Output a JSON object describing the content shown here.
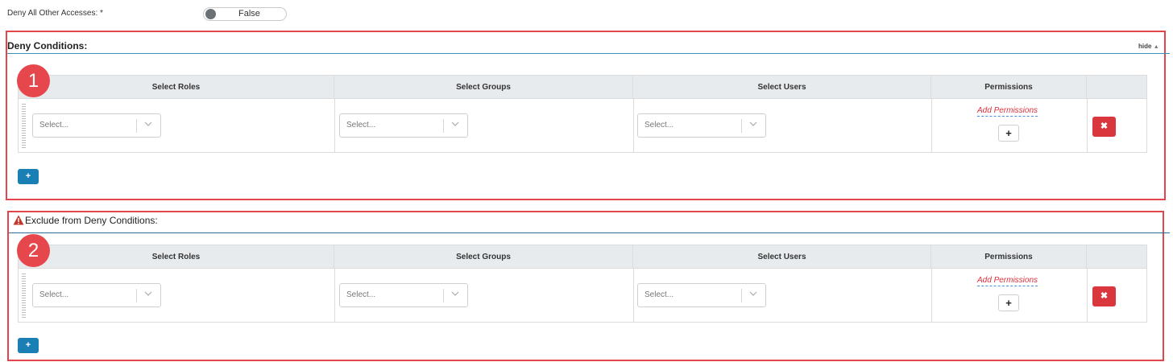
{
  "deny_all": {
    "label": "Deny All Other Accesses: *",
    "toggle_value": "False"
  },
  "deny_conditions": {
    "title": "Deny Conditions:",
    "hide_label": "hide",
    "badge": "1",
    "columns": [
      "Select Roles",
      "Select Groups",
      "Select Users",
      "Permissions"
    ],
    "row": {
      "roles_placeholder": "Select...",
      "groups_placeholder": "Select...",
      "users_placeholder": "Select...",
      "add_permissions": "Add Permissions",
      "plus": "+",
      "delete": "✖"
    },
    "add_row": "+"
  },
  "exclude_conditions": {
    "title": "Exclude from Deny Conditions:",
    "badge": "2",
    "columns": [
      "Select Roles",
      "Select Groups",
      "Select Users",
      "Permissions"
    ],
    "row": {
      "roles_placeholder": "Select...",
      "groups_placeholder": "Select...",
      "users_placeholder": "Select...",
      "add_permissions": "Add Permissions",
      "plus": "+",
      "delete": "✖"
    },
    "add_row": "+"
  },
  "colors": {
    "highlight": "#e1464b",
    "primary": "#1a7fb5",
    "danger": "#d9363e",
    "link": "#e0313a"
  }
}
